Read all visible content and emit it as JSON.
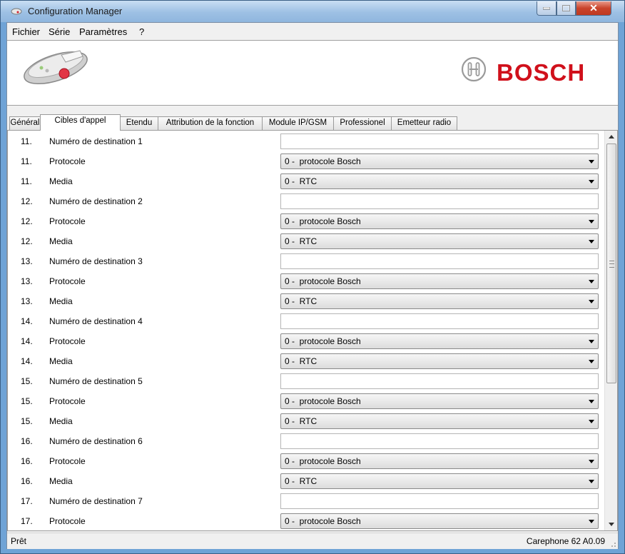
{
  "window": {
    "title": "Configuration Manager"
  },
  "menu": [
    "Fichier",
    "Série",
    "Paramètres",
    "?"
  ],
  "banner": {
    "brand": "BOSCH",
    "brand_color": "#d0101b"
  },
  "tabs": [
    {
      "label": "Général"
    },
    {
      "label": "Cibles d'appel"
    },
    {
      "label": "Etendu"
    },
    {
      "label": "Attribution de la fonction"
    },
    {
      "label": "Module IP/GSM"
    },
    {
      "label": "Professionel"
    },
    {
      "label": "Emetteur radio"
    }
  ],
  "active_tab": "Cibles d'appel",
  "rows": [
    {
      "num": "11.",
      "label": "Numéro de destination 1",
      "type": "text",
      "value": ""
    },
    {
      "num": "11.",
      "label": "Protocole",
      "type": "select",
      "value": "0 -  protocole Bosch"
    },
    {
      "num": "11.",
      "label": "Media",
      "type": "select",
      "value": "0 -  RTC"
    },
    {
      "num": "12.",
      "label": "Numéro de destination 2",
      "type": "text",
      "value": ""
    },
    {
      "num": "12.",
      "label": "Protocole",
      "type": "select",
      "value": "0 -  protocole Bosch"
    },
    {
      "num": "12.",
      "label": "Media",
      "type": "select",
      "value": "0 -  RTC"
    },
    {
      "num": "13.",
      "label": "Numéro de destination 3",
      "type": "text",
      "value": ""
    },
    {
      "num": "13.",
      "label": "Protocole",
      "type": "select",
      "value": "0 -  protocole Bosch"
    },
    {
      "num": "13.",
      "label": "Media",
      "type": "select",
      "value": "0 -  RTC"
    },
    {
      "num": "14.",
      "label": "Numéro de destination 4",
      "type": "text",
      "value": ""
    },
    {
      "num": "14.",
      "label": "Protocole",
      "type": "select",
      "value": "0 -  protocole Bosch"
    },
    {
      "num": "14.",
      "label": "Media",
      "type": "select",
      "value": "0 -  RTC"
    },
    {
      "num": "15.",
      "label": "Numéro de destination 5",
      "type": "text",
      "value": ""
    },
    {
      "num": "15.",
      "label": "Protocole",
      "type": "select",
      "value": "0 -  protocole Bosch"
    },
    {
      "num": "15.",
      "label": "Media",
      "type": "select",
      "value": "0 -  RTC"
    },
    {
      "num": "16.",
      "label": "Numéro de destination 6",
      "type": "text",
      "value": ""
    },
    {
      "num": "16.",
      "label": "Protocole",
      "type": "select",
      "value": "0 -  protocole Bosch"
    },
    {
      "num": "16.",
      "label": "Media",
      "type": "select",
      "value": "0 -  RTC"
    },
    {
      "num": "17.",
      "label": "Numéro de destination 7",
      "type": "text",
      "value": ""
    },
    {
      "num": "17.",
      "label": "Protocole",
      "type": "select",
      "value": "0 -  protocole Bosch"
    }
  ],
  "status": {
    "left": "Prêt",
    "right": "Carephone 62 A0.09"
  }
}
